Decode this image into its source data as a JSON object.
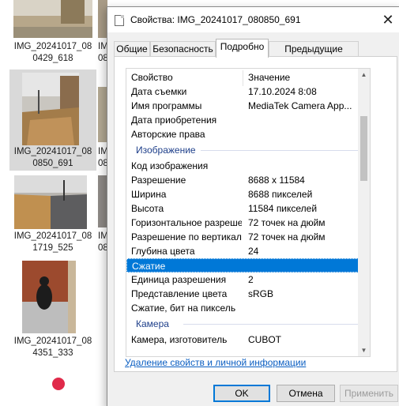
{
  "explorer": {
    "items": [
      {
        "caption_line1": "IMG_20241017_08",
        "caption_line2": "0429_618"
      },
      {
        "caption_line1": "IMG_20241017_08",
        "caption_line2": "0850_691"
      },
      {
        "caption_line1": "IMG_20241017_08",
        "caption_line2": "1719_525"
      },
      {
        "caption_line1": "IMG_20241017_08",
        "caption_line2": "4351_333"
      }
    ],
    "partial_captions": [
      "IM",
      "08",
      "IM",
      "08",
      "IM",
      "08"
    ]
  },
  "dialog": {
    "title": "Свойства: IMG_20241017_080850_691",
    "close_glyph": "✕",
    "tabs": [
      "Общие",
      "Безопасность",
      "Подробно",
      "Предыдущие версии"
    ],
    "active_tab": "Подробно",
    "list": {
      "header": {
        "property": "Свойство",
        "value": "Значение"
      },
      "rows_top": [
        {
          "k": "Дата съемки",
          "v": "17.10.2024 8:08"
        },
        {
          "k": "Имя программы",
          "v": "MediaTek Camera App..."
        },
        {
          "k": "Дата приобретения",
          "v": ""
        },
        {
          "k": "Авторские права",
          "v": ""
        }
      ],
      "section_image": "Изображение",
      "rows_image": [
        {
          "k": "Код изображения",
          "v": ""
        },
        {
          "k": "Разрешение",
          "v": "8688 x 11584"
        },
        {
          "k": "Ширина",
          "v": "8688 пикселей"
        },
        {
          "k": "Высота",
          "v": "11584 пикселей"
        },
        {
          "k": "Горизонтальное разреше...",
          "v": "72 точек на дюйм"
        },
        {
          "k": "Разрешение по вертикали",
          "v": "72 точек на дюйм"
        },
        {
          "k": "Глубина цвета",
          "v": "24"
        },
        {
          "k": "Сжатие",
          "v": ""
        },
        {
          "k": "Единица разрешения",
          "v": "2"
        },
        {
          "k": "Представление цвета",
          "v": "sRGB"
        },
        {
          "k": "Сжатие, бит на пиксель",
          "v": ""
        }
      ],
      "section_camera": "Камера",
      "rows_camera": [
        {
          "k": "Камера, изготовитель",
          "v": "CUBOT"
        }
      ],
      "selected_row": "Сжатие"
    },
    "remove_link": "Удаление свойств и личной информации",
    "buttons": {
      "ok": "OK",
      "cancel": "Отмена",
      "apply": "Применить"
    }
  },
  "colors": {
    "selection": "#0078d7",
    "section_text": "#1e3f8a",
    "link": "#0a5ec2"
  }
}
